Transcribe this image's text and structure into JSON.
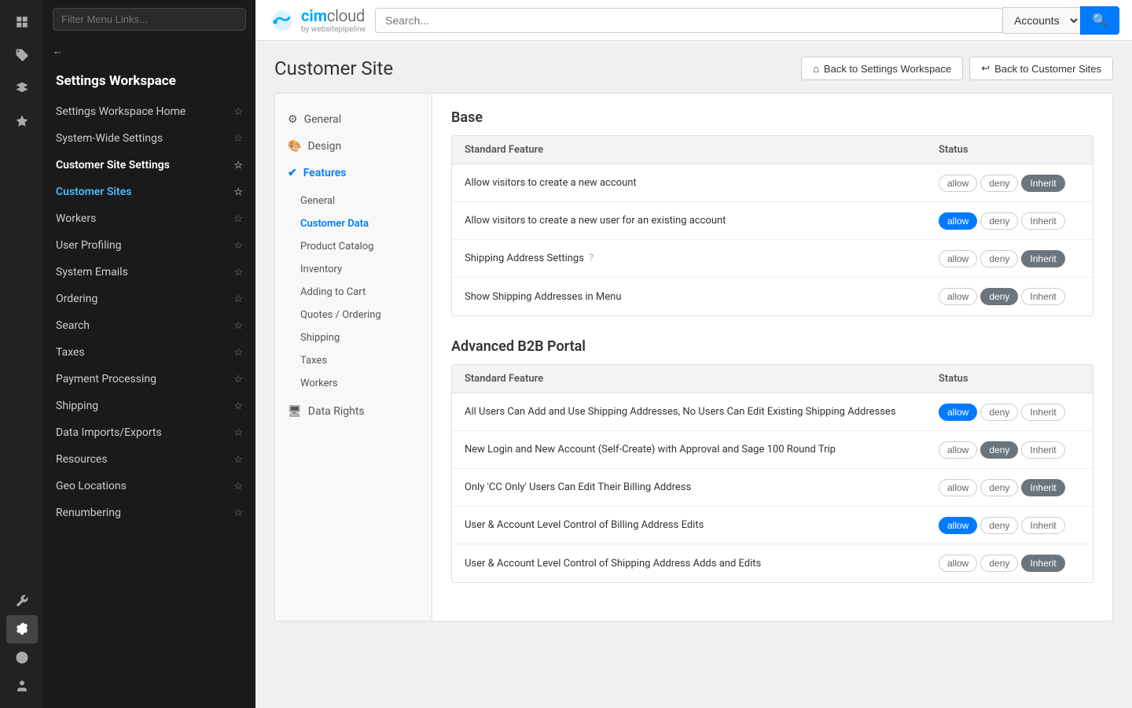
{
  "topnav": {
    "logo_text_bold": "cim",
    "logo_text_light": "cloud",
    "logo_sub": "by websitepipeline",
    "search_placeholder": "Search...",
    "search_options": [
      "Accounts"
    ],
    "search_selected": "Accounts"
  },
  "sidebar": {
    "filter_placeholder": "Filter Menu Links...",
    "title": "Settings Workspace",
    "nav_items": [
      {
        "label": "Settings Workspace Home",
        "star": true
      },
      {
        "label": "System-Wide Settings",
        "star": false
      },
      {
        "label": "Customer Site Settings",
        "bold": true,
        "star": false
      },
      {
        "label": "Customer Sites",
        "active": true,
        "star": true
      },
      {
        "label": "Workers",
        "star": false
      },
      {
        "label": "User Profiling",
        "star": false
      },
      {
        "label": "System Emails",
        "star": false
      },
      {
        "label": "Ordering",
        "star": false
      },
      {
        "label": "Search",
        "star": false
      },
      {
        "label": "Taxes",
        "star": false
      },
      {
        "label": "Payment Processing",
        "star": false
      },
      {
        "label": "Shipping",
        "star": false
      },
      {
        "label": "Data Imports/Exports",
        "star": false
      },
      {
        "label": "Resources",
        "star": false
      },
      {
        "label": "Geo Locations",
        "star": false
      },
      {
        "label": "Renumbering",
        "star": false
      }
    ]
  },
  "page": {
    "title": "Customer Site",
    "btn_back_settings": "Back to Settings Workspace",
    "btn_back_sites": "Back to Customer Sites"
  },
  "feature_nav": {
    "items": [
      {
        "label": "General",
        "icon": "⚙"
      },
      {
        "label": "Design",
        "icon": "🎨"
      },
      {
        "label": "Features",
        "icon": "✔",
        "active": true
      }
    ],
    "sub_items": [
      {
        "label": "General"
      },
      {
        "label": "Customer Data",
        "active": true
      },
      {
        "label": "Product Catalog"
      },
      {
        "label": "Inventory"
      },
      {
        "label": "Adding to Cart"
      },
      {
        "label": "Quotes / Ordering"
      },
      {
        "label": "Shipping"
      },
      {
        "label": "Taxes"
      },
      {
        "label": "Workers"
      }
    ],
    "data_rights": {
      "label": "Data Rights",
      "icon": "🖥"
    }
  },
  "base_section": {
    "title": "Base",
    "col_feature": "Standard Feature",
    "col_status": "Status",
    "rows": [
      {
        "name": "Allow visitors to create a new account",
        "allow": false,
        "deny": false,
        "inherit": true
      },
      {
        "name": "Allow visitors to create a new user for an existing account",
        "allow": true,
        "deny": false,
        "inherit": false
      },
      {
        "name": "Shipping Address Settings",
        "has_help": true,
        "allow": false,
        "deny": false,
        "inherit": true
      },
      {
        "name": "Show Shipping Addresses in Menu",
        "allow": false,
        "deny": true,
        "inherit": false
      }
    ]
  },
  "advanced_section": {
    "title": "Advanced B2B Portal",
    "col_feature": "Standard Feature",
    "col_status": "Status",
    "rows": [
      {
        "name": "All Users Can Add and Use Shipping Addresses, No Users Can Edit Existing Shipping Addresses",
        "allow": true,
        "deny": false,
        "inherit": false
      },
      {
        "name": "New Login and New Account (Self-Create) with Approval and Sage 100 Round Trip",
        "allow": false,
        "deny": true,
        "inherit": false
      },
      {
        "name": "Only 'CC Only' Users Can Edit Their Billing Address",
        "allow": false,
        "deny": false,
        "inherit": true
      },
      {
        "name": "User & Account Level Control of Billing Address Edits",
        "allow": true,
        "deny": false,
        "inherit": false
      },
      {
        "name": "User & Account Level Control of Shipping Address Adds and Edits",
        "allow": false,
        "deny": false,
        "inherit": true
      }
    ]
  },
  "labels": {
    "allow": "allow",
    "deny": "deny",
    "inherit": "Inherit"
  }
}
